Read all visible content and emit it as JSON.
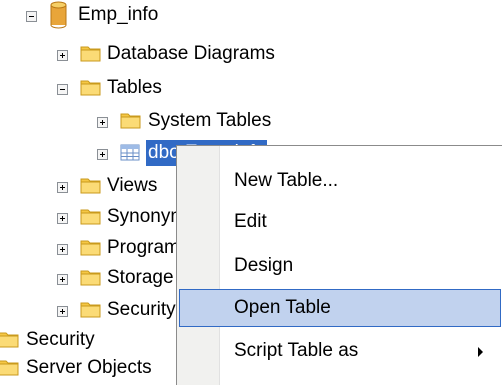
{
  "tree": {
    "database": "Emp_info",
    "database_diagrams": "Database Diagrams",
    "tables": "Tables",
    "system_tables": "System Tables",
    "selected_table": "dbo.Emp_info",
    "views": "Views",
    "synonyms": "Synonyms",
    "programmability": "Programmability",
    "storage": "Storage",
    "security_child": "Security",
    "security": "Security",
    "server_objects": "Server Objects"
  },
  "context_menu": {
    "items": [
      "New Table...",
      "Edit",
      "Design",
      "Open Table",
      "Script Table as"
    ],
    "highlighted": "Open Table"
  },
  "colors": {
    "selection": "#316ac5",
    "menu_highlight": "#c1d2ee",
    "folder": "#f5c745",
    "database_icon": "#e8a53a"
  },
  "icons": [
    "minus-icon",
    "plus-icon",
    "folder-icon",
    "database-icon",
    "table-icon",
    "submenu-arrow-icon"
  ]
}
